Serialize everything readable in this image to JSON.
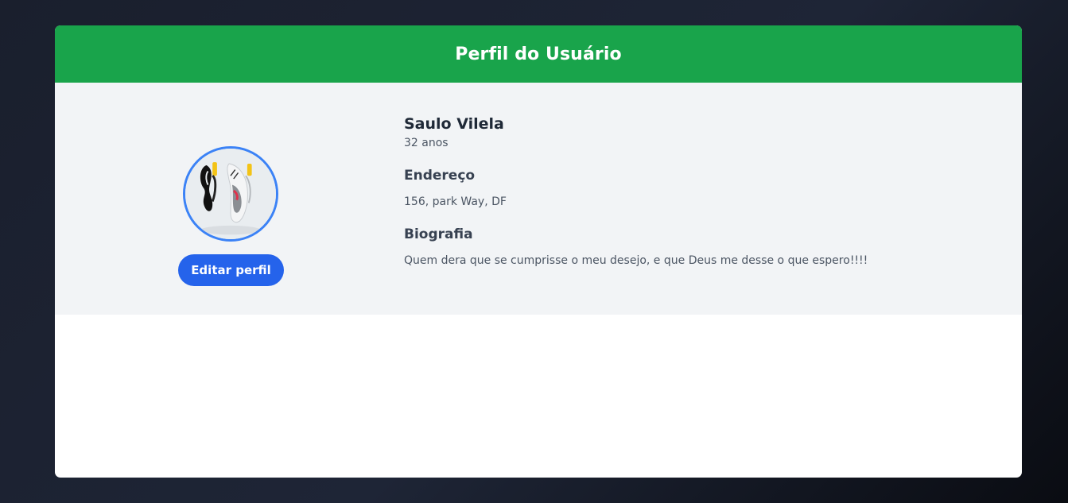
{
  "header": {
    "title": "Perfil do Usuário"
  },
  "profile": {
    "avatar_icon": "profile-photo-sneakers",
    "edit_button_label": "Editar perfil",
    "name": "Saulo Vilela",
    "age": "32 anos",
    "address_heading": "Endereço",
    "address": "156, park Way, DF",
    "bio_heading": "Biografia",
    "bio": "Quem dera que se cumprisse o meu desejo, e que Deus me desse o que espero!!!!"
  },
  "colors": {
    "header_bg": "#19a44b",
    "section_bg": "#f2f4f6",
    "button_bg": "#2563eb",
    "avatar_border": "#3b82f6"
  }
}
